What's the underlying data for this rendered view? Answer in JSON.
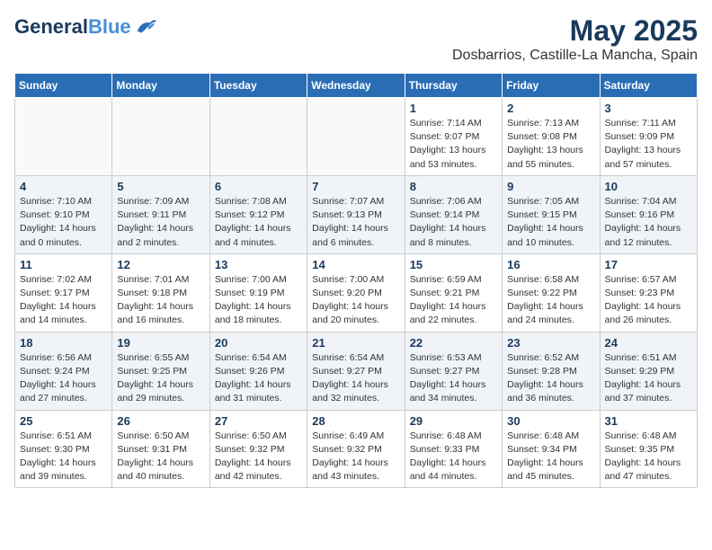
{
  "header": {
    "logo_line1": "General",
    "logo_line2": "Blue",
    "month": "May 2025",
    "location": "Dosbarrios, Castille-La Mancha, Spain"
  },
  "weekdays": [
    "Sunday",
    "Monday",
    "Tuesday",
    "Wednesday",
    "Thursday",
    "Friday",
    "Saturday"
  ],
  "weeks": [
    [
      {
        "day": "",
        "info": ""
      },
      {
        "day": "",
        "info": ""
      },
      {
        "day": "",
        "info": ""
      },
      {
        "day": "",
        "info": ""
      },
      {
        "day": "1",
        "info": "Sunrise: 7:14 AM\nSunset: 9:07 PM\nDaylight: 13 hours\nand 53 minutes."
      },
      {
        "day": "2",
        "info": "Sunrise: 7:13 AM\nSunset: 9:08 PM\nDaylight: 13 hours\nand 55 minutes."
      },
      {
        "day": "3",
        "info": "Sunrise: 7:11 AM\nSunset: 9:09 PM\nDaylight: 13 hours\nand 57 minutes."
      }
    ],
    [
      {
        "day": "4",
        "info": "Sunrise: 7:10 AM\nSunset: 9:10 PM\nDaylight: 14 hours\nand 0 minutes."
      },
      {
        "day": "5",
        "info": "Sunrise: 7:09 AM\nSunset: 9:11 PM\nDaylight: 14 hours\nand 2 minutes."
      },
      {
        "day": "6",
        "info": "Sunrise: 7:08 AM\nSunset: 9:12 PM\nDaylight: 14 hours\nand 4 minutes."
      },
      {
        "day": "7",
        "info": "Sunrise: 7:07 AM\nSunset: 9:13 PM\nDaylight: 14 hours\nand 6 minutes."
      },
      {
        "day": "8",
        "info": "Sunrise: 7:06 AM\nSunset: 9:14 PM\nDaylight: 14 hours\nand 8 minutes."
      },
      {
        "day": "9",
        "info": "Sunrise: 7:05 AM\nSunset: 9:15 PM\nDaylight: 14 hours\nand 10 minutes."
      },
      {
        "day": "10",
        "info": "Sunrise: 7:04 AM\nSunset: 9:16 PM\nDaylight: 14 hours\nand 12 minutes."
      }
    ],
    [
      {
        "day": "11",
        "info": "Sunrise: 7:02 AM\nSunset: 9:17 PM\nDaylight: 14 hours\nand 14 minutes."
      },
      {
        "day": "12",
        "info": "Sunrise: 7:01 AM\nSunset: 9:18 PM\nDaylight: 14 hours\nand 16 minutes."
      },
      {
        "day": "13",
        "info": "Sunrise: 7:00 AM\nSunset: 9:19 PM\nDaylight: 14 hours\nand 18 minutes."
      },
      {
        "day": "14",
        "info": "Sunrise: 7:00 AM\nSunset: 9:20 PM\nDaylight: 14 hours\nand 20 minutes."
      },
      {
        "day": "15",
        "info": "Sunrise: 6:59 AM\nSunset: 9:21 PM\nDaylight: 14 hours\nand 22 minutes."
      },
      {
        "day": "16",
        "info": "Sunrise: 6:58 AM\nSunset: 9:22 PM\nDaylight: 14 hours\nand 24 minutes."
      },
      {
        "day": "17",
        "info": "Sunrise: 6:57 AM\nSunset: 9:23 PM\nDaylight: 14 hours\nand 26 minutes."
      }
    ],
    [
      {
        "day": "18",
        "info": "Sunrise: 6:56 AM\nSunset: 9:24 PM\nDaylight: 14 hours\nand 27 minutes."
      },
      {
        "day": "19",
        "info": "Sunrise: 6:55 AM\nSunset: 9:25 PM\nDaylight: 14 hours\nand 29 minutes."
      },
      {
        "day": "20",
        "info": "Sunrise: 6:54 AM\nSunset: 9:26 PM\nDaylight: 14 hours\nand 31 minutes."
      },
      {
        "day": "21",
        "info": "Sunrise: 6:54 AM\nSunset: 9:27 PM\nDaylight: 14 hours\nand 32 minutes."
      },
      {
        "day": "22",
        "info": "Sunrise: 6:53 AM\nSunset: 9:27 PM\nDaylight: 14 hours\nand 34 minutes."
      },
      {
        "day": "23",
        "info": "Sunrise: 6:52 AM\nSunset: 9:28 PM\nDaylight: 14 hours\nand 36 minutes."
      },
      {
        "day": "24",
        "info": "Sunrise: 6:51 AM\nSunset: 9:29 PM\nDaylight: 14 hours\nand 37 minutes."
      }
    ],
    [
      {
        "day": "25",
        "info": "Sunrise: 6:51 AM\nSunset: 9:30 PM\nDaylight: 14 hours\nand 39 minutes."
      },
      {
        "day": "26",
        "info": "Sunrise: 6:50 AM\nSunset: 9:31 PM\nDaylight: 14 hours\nand 40 minutes."
      },
      {
        "day": "27",
        "info": "Sunrise: 6:50 AM\nSunset: 9:32 PM\nDaylight: 14 hours\nand 42 minutes."
      },
      {
        "day": "28",
        "info": "Sunrise: 6:49 AM\nSunset: 9:32 PM\nDaylight: 14 hours\nand 43 minutes."
      },
      {
        "day": "29",
        "info": "Sunrise: 6:48 AM\nSunset: 9:33 PM\nDaylight: 14 hours\nand 44 minutes."
      },
      {
        "day": "30",
        "info": "Sunrise: 6:48 AM\nSunset: 9:34 PM\nDaylight: 14 hours\nand 45 minutes."
      },
      {
        "day": "31",
        "info": "Sunrise: 6:48 AM\nSunset: 9:35 PM\nDaylight: 14 hours\nand 47 minutes."
      }
    ]
  ]
}
